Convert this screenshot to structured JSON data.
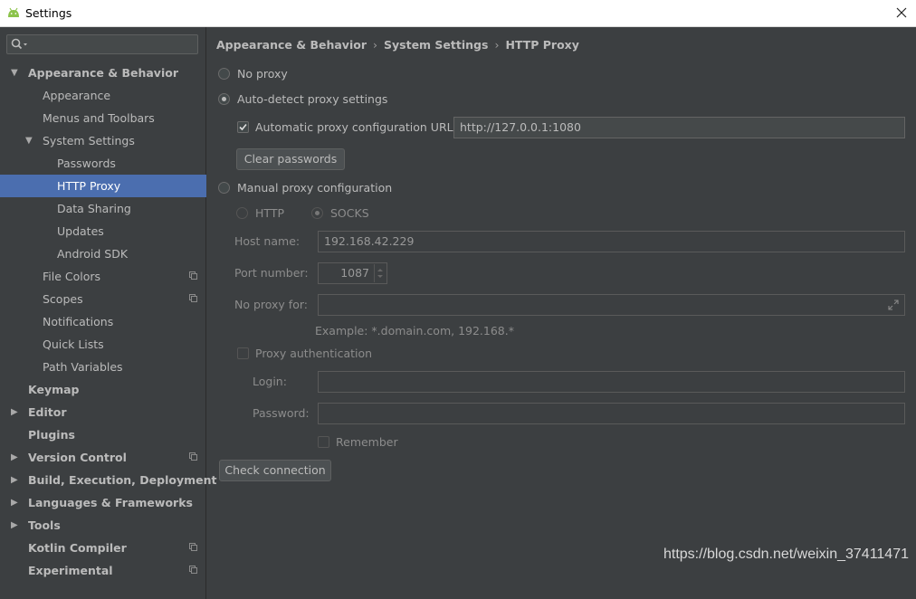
{
  "window": {
    "title": "Settings",
    "app_icon": "android-icon",
    "close_icon": "close-icon"
  },
  "sidebar": {
    "search": {
      "icon": "search-icon",
      "placeholder": ""
    },
    "items": [
      {
        "label": "Appearance & Behavior",
        "level": 0,
        "bold": true,
        "expand": "open",
        "selected": false,
        "project_icon": false
      },
      {
        "label": "Appearance",
        "level": 1,
        "bold": false,
        "expand": "none",
        "selected": false,
        "project_icon": false
      },
      {
        "label": "Menus and Toolbars",
        "level": 1,
        "bold": false,
        "expand": "none",
        "selected": false,
        "project_icon": false
      },
      {
        "label": "System Settings",
        "level": 1,
        "bold": false,
        "expand": "open",
        "selected": false,
        "project_icon": false
      },
      {
        "label": "Passwords",
        "level": 2,
        "bold": false,
        "expand": "none",
        "selected": false,
        "project_icon": false
      },
      {
        "label": "HTTP Proxy",
        "level": 2,
        "bold": false,
        "expand": "none",
        "selected": true,
        "project_icon": false
      },
      {
        "label": "Data Sharing",
        "level": 2,
        "bold": false,
        "expand": "none",
        "selected": false,
        "project_icon": false
      },
      {
        "label": "Updates",
        "level": 2,
        "bold": false,
        "expand": "none",
        "selected": false,
        "project_icon": false
      },
      {
        "label": "Android SDK",
        "level": 2,
        "bold": false,
        "expand": "none",
        "selected": false,
        "project_icon": false
      },
      {
        "label": "File Colors",
        "level": 1,
        "bold": false,
        "expand": "none",
        "selected": false,
        "project_icon": true
      },
      {
        "label": "Scopes",
        "level": 1,
        "bold": false,
        "expand": "none",
        "selected": false,
        "project_icon": true
      },
      {
        "label": "Notifications",
        "level": 1,
        "bold": false,
        "expand": "none",
        "selected": false,
        "project_icon": false
      },
      {
        "label": "Quick Lists",
        "level": 1,
        "bold": false,
        "expand": "none",
        "selected": false,
        "project_icon": false
      },
      {
        "label": "Path Variables",
        "level": 1,
        "bold": false,
        "expand": "none",
        "selected": false,
        "project_icon": false
      },
      {
        "label": "Keymap",
        "level": 0,
        "bold": true,
        "expand": "none",
        "selected": false,
        "project_icon": false
      },
      {
        "label": "Editor",
        "level": 0,
        "bold": true,
        "expand": "closed",
        "selected": false,
        "project_icon": false
      },
      {
        "label": "Plugins",
        "level": 0,
        "bold": true,
        "expand": "none",
        "selected": false,
        "project_icon": false
      },
      {
        "label": "Version Control",
        "level": 0,
        "bold": true,
        "expand": "closed",
        "selected": false,
        "project_icon": true
      },
      {
        "label": "Build, Execution, Deployment",
        "level": 0,
        "bold": true,
        "expand": "closed",
        "selected": false,
        "project_icon": false
      },
      {
        "label": "Languages & Frameworks",
        "level": 0,
        "bold": true,
        "expand": "closed",
        "selected": false,
        "project_icon": false
      },
      {
        "label": "Tools",
        "level": 0,
        "bold": true,
        "expand": "closed",
        "selected": false,
        "project_icon": false
      },
      {
        "label": "Kotlin Compiler",
        "level": 0,
        "bold": true,
        "expand": "none",
        "selected": false,
        "project_icon": true
      },
      {
        "label": "Experimental",
        "level": 0,
        "bold": true,
        "expand": "none",
        "selected": false,
        "project_icon": true
      }
    ]
  },
  "breadcrumb": [
    "Appearance & Behavior",
    "System Settings",
    "HTTP Proxy"
  ],
  "proxy": {
    "no_proxy": {
      "label": "No proxy",
      "selected": false
    },
    "auto_detect": {
      "label": "Auto-detect proxy settings",
      "selected": true
    },
    "auto_config_url": {
      "label": "Automatic proxy configuration URL:",
      "checked": true,
      "value": "http://127.0.0.1:1080"
    },
    "clear_passwords": "Clear passwords",
    "manual": {
      "label": "Manual proxy configuration",
      "selected": false
    },
    "type_http": {
      "label": "HTTP",
      "selected": false
    },
    "type_socks": {
      "label": "SOCKS",
      "selected": true
    },
    "host_name": {
      "label": "Host name:",
      "value": "192.168.42.229"
    },
    "port_number": {
      "label": "Port number:",
      "value": "1087"
    },
    "no_proxy_for": {
      "label": "No proxy for:",
      "value": "",
      "expand_icon": "expand-icon"
    },
    "example": "Example: *.domain.com, 192.168.*",
    "proxy_auth": {
      "label": "Proxy authentication",
      "checked": false
    },
    "login": {
      "label": "Login:",
      "value": ""
    },
    "password": {
      "label": "Password:",
      "value": ""
    },
    "remember": {
      "label": "Remember",
      "checked": false
    },
    "check_connection": "Check connection"
  },
  "watermark": "https://blog.csdn.net/weixin_37411471",
  "colors": {
    "background": "#3c3f41",
    "selection": "#4b6eaf",
    "text": "#bbbbbb"
  }
}
